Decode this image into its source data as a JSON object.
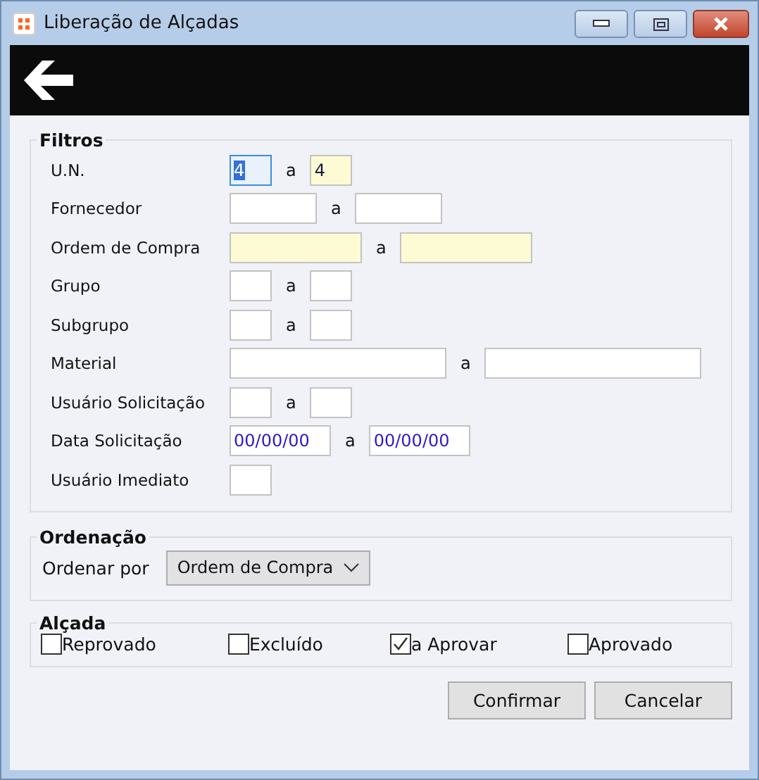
{
  "window": {
    "title": "Liberação de Alçadas"
  },
  "filters": {
    "title": "Filtros",
    "rows": [
      {
        "label": "U.N.",
        "kind": "tiny",
        "fields": [
          {
            "value": "4",
            "mandatory": false,
            "focused": true
          },
          {
            "value": "4",
            "mandatory": true,
            "focused": false
          }
        ],
        "separator": "a"
      },
      {
        "label": "Fornecedor",
        "kind": "medium",
        "fields": [
          {
            "mandatory": false,
            "focused": false
          },
          {
            "mandatory": false,
            "focused": false
          }
        ],
        "separator": "a"
      },
      {
        "label": "Ordem de Compra",
        "kind": "large",
        "fields": [
          {
            "mandatory": true,
            "focused": false
          },
          {
            "mandatory": true,
            "focused": false
          }
        ],
        "separator": "a"
      },
      {
        "label": "Grupo",
        "kind": "tiny",
        "fields": [
          {
            "mandatory": false,
            "focused": false
          },
          {
            "mandatory": false,
            "focused": false
          }
        ],
        "separator": "a"
      },
      {
        "label": "Subgrupo",
        "kind": "tiny",
        "fields": [
          {
            "mandatory": false,
            "focused": false
          },
          {
            "mandatory": false,
            "focused": false
          }
        ],
        "separator": "a"
      },
      {
        "label": "Material",
        "kind": "wide",
        "fields": [
          {
            "mandatory": false,
            "focused": false
          },
          {
            "mandatory": false,
            "focused": false
          }
        ],
        "separator": "a"
      },
      {
        "label": "Usuário Solicitação",
        "kind": "tiny",
        "fields": [
          {
            "mandatory": false,
            "focused": false
          },
          {
            "mandatory": false,
            "focused": false
          }
        ],
        "separator": "a"
      },
      {
        "label": "Data Solicitação",
        "kind": "date",
        "fields": [
          {
            "value": "00/00/00",
            "mandatory": false,
            "focused": false
          },
          {
            "value": "00/00/00",
            "mandatory": false,
            "focused": false
          }
        ],
        "separator": "a"
      },
      {
        "label": "Usuário Imediato",
        "kind": "tiny",
        "fields": [
          {
            "mandatory": false,
            "focused": false
          }
        ]
      }
    ]
  },
  "ordering": {
    "title": "Ordenação",
    "label": "Ordenar por",
    "value": "Ordem de Compra"
  },
  "approval": {
    "title": "Alçada",
    "options": [
      {
        "label": "Reprovado",
        "checked": false
      },
      {
        "label": "Excluído",
        "checked": false
      },
      {
        "label": "a Aprovar",
        "checked": true
      },
      {
        "label": "Aprovado",
        "checked": false
      }
    ]
  },
  "buttons": [
    "Confirmar",
    "Cancelar"
  ]
}
